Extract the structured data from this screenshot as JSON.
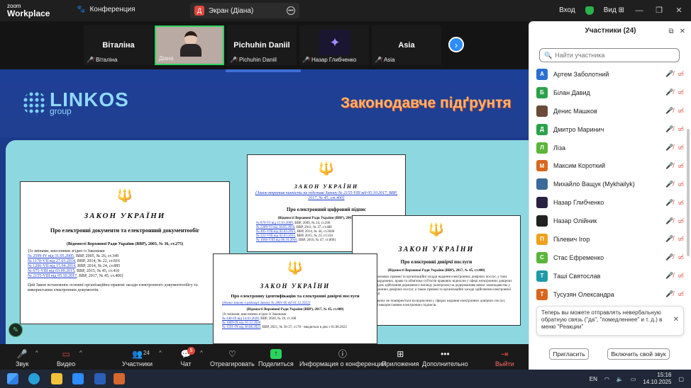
{
  "titlebar": {
    "logo_line1": "zoom",
    "logo_line2": "Workplace",
    "meeting_tab": "Конференция",
    "screen_tab": "Экран (Діана)",
    "screen_badge": "Д",
    "signin": "Вход",
    "view": "Вид"
  },
  "strip": {
    "tiles": [
      {
        "big": "Віталіна",
        "label": "Віталіна"
      },
      {
        "big": "",
        "label": "Діана"
      },
      {
        "big": "Pichuhin Daniil",
        "label": "Pichuhin Daniil"
      },
      {
        "big": "",
        "label": "Назар Глибченко"
      },
      {
        "big": "Asia",
        "label": "Asia"
      }
    ]
  },
  "slide": {
    "logo_main": "LINKOS",
    "logo_sub": "group",
    "title": "Законодавче підґрунтя",
    "doc1": {
      "law": "ЗАКОН УКРАЇНИ",
      "title": "Про електронні документи та електронний документообіг",
      "sub": "(Відомості Верховної Ради України (ВВР), 2003, № 36, ст.275)",
      "intro": "{Із змінами, внесеними згідно із Законами",
      "refs": [
        "№ 2599-IV від 31.05.2005",
        "№ 1170-VII від 27.03.2014",
        "№ 1206-VII від 15.04.2014",
        "№ 675-VIII від 03.09.2015",
        "№ 2155-VIII від 05.10.2017"
      ],
      "refs_tail": [
        "ВВР, 2005, № 26, ст.349",
        "ВВР, 2014, № 22, ст.816",
        "ВВР, 2014, № 24, ст.885",
        "ВВР, 2015, № 45, ст.410",
        "ВВР, 2017, № 45, ст.400}"
      ],
      "body": "Цей Закон встановлює основні організаційно-правові засади електронного документообігу та використання електронних документів."
    },
    "doc2": {
      "law": "ЗАКОН УКРАЇНИ",
      "note": "{Закон втратив чинність на підставі Закону № 2155-VIII від 05.10.2017, ВВР, 2017, № 45, ст.400}",
      "title": "Про електронний цифровий підпис",
      "sub": "(Відомості Верховної Ради України (ВВР), 2003, № 36, ст.276)",
      "refs": [
        "№ 879-VI від 15.01.2009",
        "№ 2289-VI від 18.05.2010",
        "№ 405-VIII від 02.03.2015",
        "№ 222-VIII від 02.03.2015",
        "№ 1666-VIII від 06.10.2016"
      ],
      "refs_tail": [
        "ВВР, 2009, № 24, ст.296",
        "ВВР, 2011, № 37, ст.488",
        "ВВР, 2014, № 44, ст.2040",
        "ВВР, 2015, № 23, ст.158",
        "ВВР, 2016, № 47, ст.800}"
      ]
    },
    "doc3": {
      "law": "ЗАКОН УКРАЇНИ",
      "title": "Про електронні довірчі послуги",
      "sub": "(Відомості Верховної Ради України (ВВР), 2017, № 45, ст.400)",
      "body": "Цей Закон визначає правові та організаційні засади надання електронних довірчих послуг, у тому числі транскордонних, права та обов'язки суб'єктів правових відносин у сфері електронних довірчих послуг, порядок здійснення державного нагляду (контролю) за додержанням вимог законодавства у сфері електронних довірчих послуг, а також правові та організаційні засади здійснення електронної ідентифікації.",
      "body2": "Дія цього Закону не поширюється на відносини у сферах надання електронних довірчих послуг, пов'язаних з використанням електронних підписів."
    },
    "doc4": {
      "law": "ЗАКОН УКРАЇНИ",
      "title": "Про електронну ідентифікацію та електронні довірчі послуги",
      "note": "{Назва Закону в редакції Закону № 2801-IX від 01.12.2022}",
      "sub": "(Відомості Верховної Ради України (ВВР), 2017, № 45, ст.400)",
      "intro": "{Із змінами, внесеними згідно із Законами",
      "refs": [
        "№ 440-IX від 14.01.2020",
        "№ 1089-IX від 16.12.2020",
        "№ 1591-IX від 30.06.2021"
      ],
      "refs_tail": [
        "ВВР, 2020, № 26, ст.168",
        "",
        "ВВР, 2021, № 36-37, ст.78 - вводиться в дію з 01.08.2022"
      ]
    }
  },
  "toolbar": {
    "audio": "Звук",
    "video": "Видео",
    "participants": "Участники",
    "participants_count": "24",
    "chat": "Чат",
    "chat_badge": "5",
    "react": "Отреагировать",
    "share": "Поделиться",
    "info": "Информация о конференции",
    "apps": "Приложения",
    "more": "Дополнительно",
    "leave": "Выйти"
  },
  "panel": {
    "title": "Участники (24)",
    "search_placeholder": "Найти участника",
    "participants": [
      {
        "initial": "А",
        "color": "#2b6fd1",
        "name": "Артем Заболотний"
      },
      {
        "initial": "Б",
        "color": "#2ba14b",
        "name": "Білан Давид"
      },
      {
        "initial": "",
        "color": "#6b4a3a",
        "name": "Денис Машков"
      },
      {
        "initial": "Д",
        "color": "#2ba14b",
        "name": "Дмитро Маринич"
      },
      {
        "initial": "Л",
        "color": "#5ab53a",
        "name": "Ліза"
      },
      {
        "initial": "М",
        "color": "#d9661f",
        "name": "Максим Короткий"
      },
      {
        "initial": "",
        "color": "#3a6b9a",
        "name": "Михайло Ващук (Mykhailyk)"
      },
      {
        "initial": "",
        "color": "#2a2140",
        "name": "Назар Глибченко"
      },
      {
        "initial": "",
        "color": "#222222",
        "name": "Назар Олійник"
      },
      {
        "initial": "П",
        "color": "#f0a01c",
        "name": "Пілевич Ігор"
      },
      {
        "initial": "С",
        "color": "#5ab53a",
        "name": "Стас Ефременко"
      },
      {
        "initial": "Т",
        "color": "#1f9aa8",
        "name": "Таші Святослав"
      },
      {
        "initial": "Т",
        "color": "#d9661f",
        "name": "Тусузян Олександра"
      }
    ],
    "notice": "Теперь вы можете отправлять невербальную обратную связь (\"да\", \"помедленнее\" и т. д.) в меню \"Реакции\"",
    "invite": "Пригласить",
    "unmute": "Включить свой звук"
  },
  "taskbar": {
    "lang": "EN",
    "time": "15:16",
    "date": "14.10.2025"
  }
}
